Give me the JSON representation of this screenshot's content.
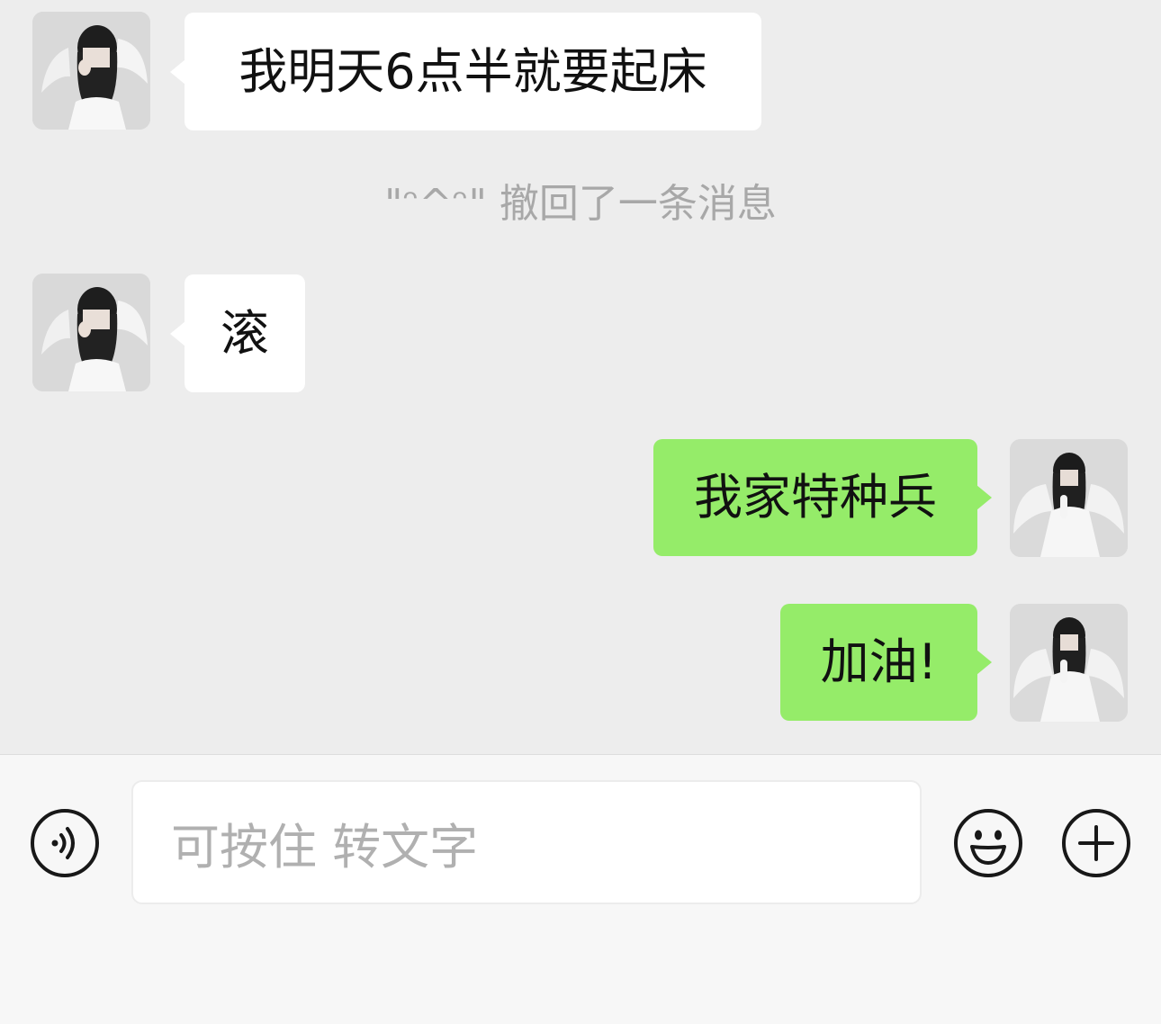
{
  "messages": [
    {
      "sender": "contact",
      "text": "我明天6点半就要起床"
    },
    {
      "sender": "contact",
      "text": "滚"
    },
    {
      "sender": "me",
      "text": "我家特种兵"
    },
    {
      "sender": "me",
      "text": "加油!"
    }
  ],
  "system_notice": "\"ᵔ^ᵔ\" 撤回了一条消息",
  "input_bar": {
    "placeholder": "可按住 转文字",
    "voice_icon": "voice-icon",
    "emoji_icon": "emoji-icon",
    "add_icon": "plus-icon"
  },
  "colors": {
    "background": "#ededed",
    "incoming_bubble": "#ffffff",
    "outgoing_bubble": "#95ec69",
    "system_text": "#a8a8a8",
    "input_bar": "#f7f7f7"
  }
}
